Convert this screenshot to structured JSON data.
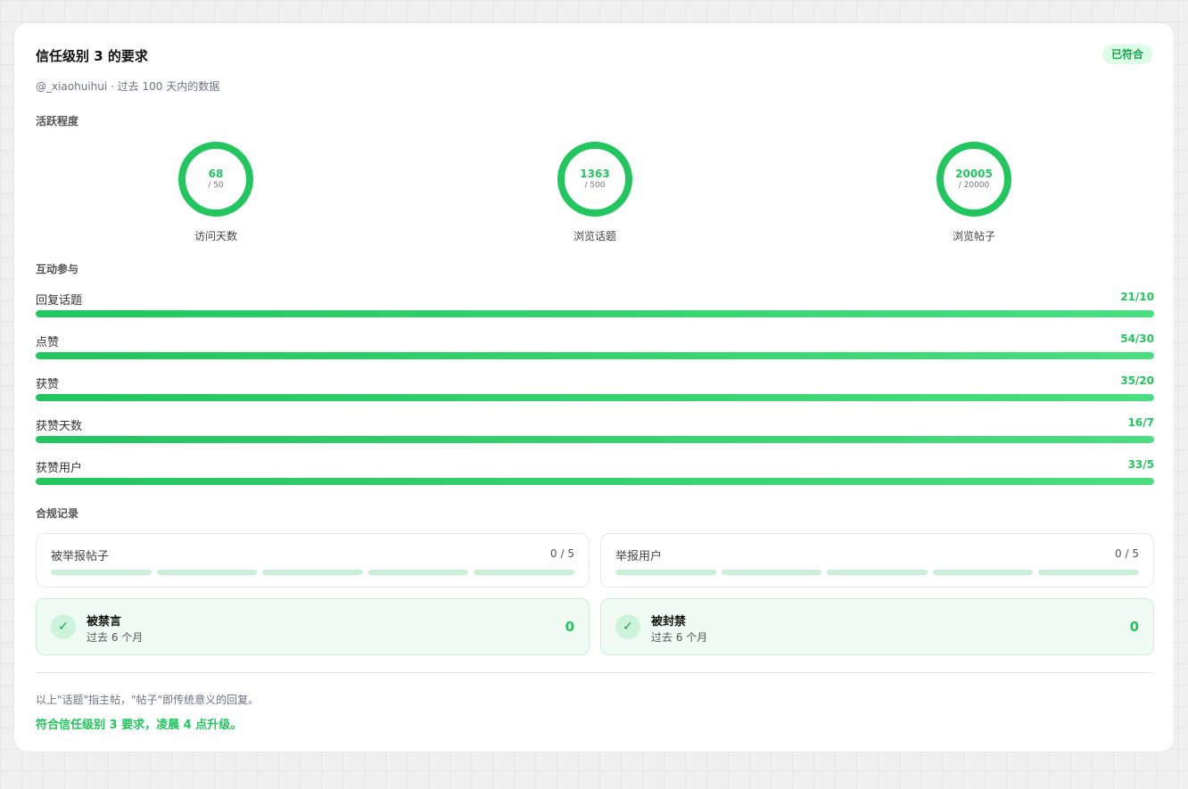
{
  "header": {
    "title": "信任级别 3 的要求",
    "badge": "已符合",
    "subtitle": "@_xiaohuihui · 过去 100 天内的数据"
  },
  "activity": {
    "section_label": "活跃程度",
    "rings": [
      {
        "value": "68",
        "target": "/ 50",
        "label": "访问天数"
      },
      {
        "value": "1363",
        "target": "/ 500",
        "label": "浏览话题"
      },
      {
        "value": "20005",
        "target": "/ 20000",
        "label": "浏览帖子"
      }
    ]
  },
  "engagement": {
    "section_label": "互动参与",
    "bars": [
      {
        "label": "回复话题",
        "value": "21/10",
        "progress": 1.0
      },
      {
        "label": "点赞",
        "value": "54/30",
        "progress": 1.0
      },
      {
        "label": "获赞",
        "value": "35/20",
        "progress": 1.0
      },
      {
        "label": "获赞天数",
        "value": "16/7",
        "progress": 1.0
      },
      {
        "label": "获赞用户",
        "value": "33/5",
        "progress": 1.0
      }
    ]
  },
  "compliance": {
    "section_label": "合规记录",
    "reported": [
      {
        "label": "被举报帖子",
        "value": "0 / 5",
        "filled": 0
      },
      {
        "label": "举报用户",
        "value": "0 / 5",
        "filled": 0
      }
    ],
    "penalties": [
      {
        "title": "被禁言",
        "subtitle": "过去 6 个月",
        "count": "0"
      },
      {
        "title": "被封禁",
        "subtitle": "过去 6 个月",
        "count": "0"
      }
    ]
  },
  "footer": {
    "note": "以上\"话题\"指主帖，\"帖子\"即传统意义的回复。",
    "conclusion": "符合信任级别 3 要求，凌晨 4 点升级。"
  },
  "icons": {
    "check": "check-icon"
  },
  "colors": {
    "accent": "#22c55e",
    "badge_bg": "#dcfce7",
    "segment": "#c9efd6",
    "penalty_bg": "#effbf3"
  }
}
